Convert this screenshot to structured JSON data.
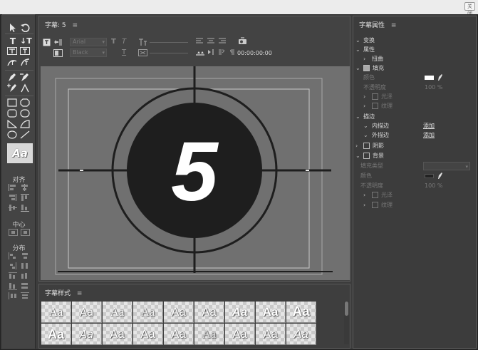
{
  "window": {
    "close_label": "关闭"
  },
  "toolbox": {
    "align_label": "对齐",
    "center_label": "中心",
    "distribute_label": "分布",
    "style_preview": "Aa"
  },
  "title_panel": {
    "tab_label": "字幕: 5",
    "menu_icon": "≡",
    "font_family": "Arial",
    "font_style": "Black",
    "timecode": "00:00:00:00",
    "graphic_text": "5"
  },
  "styles_panel": {
    "tab_label": "字幕样式",
    "menu_icon": "≡",
    "swatches": [
      "Aa",
      "Aa",
      "Aa",
      "Aa",
      "Aa",
      "Aa",
      "Aa",
      "Aa",
      "Aa",
      "Aa",
      "Aa",
      "Aa",
      "Aa",
      "Aa",
      "Aa",
      "Aa",
      "Aa",
      "Aa"
    ]
  },
  "properties": {
    "tab_label": "字幕属性",
    "menu_icon": "≡",
    "transform": "变换",
    "attributes": "属性",
    "distort": "扭曲",
    "fill": "填充",
    "color": "颜色",
    "opacity": "不透明度",
    "opacity_value": "100 %",
    "sheen": "光泽",
    "texture": "纹理",
    "stroke": "描边",
    "inner_stroke": "内描边",
    "outer_stroke": "外描边",
    "add": "添加",
    "shadow": "阴影",
    "background": "背景",
    "fill_type": "填充类型",
    "bg_color": "颜色",
    "bg_opacity": "不透明度",
    "bg_opacity_value": "100 %",
    "bg_sheen": "光泽",
    "bg_texture": "纹理",
    "fill_color": "#ffffff",
    "bg_fill_color": "#222222"
  }
}
